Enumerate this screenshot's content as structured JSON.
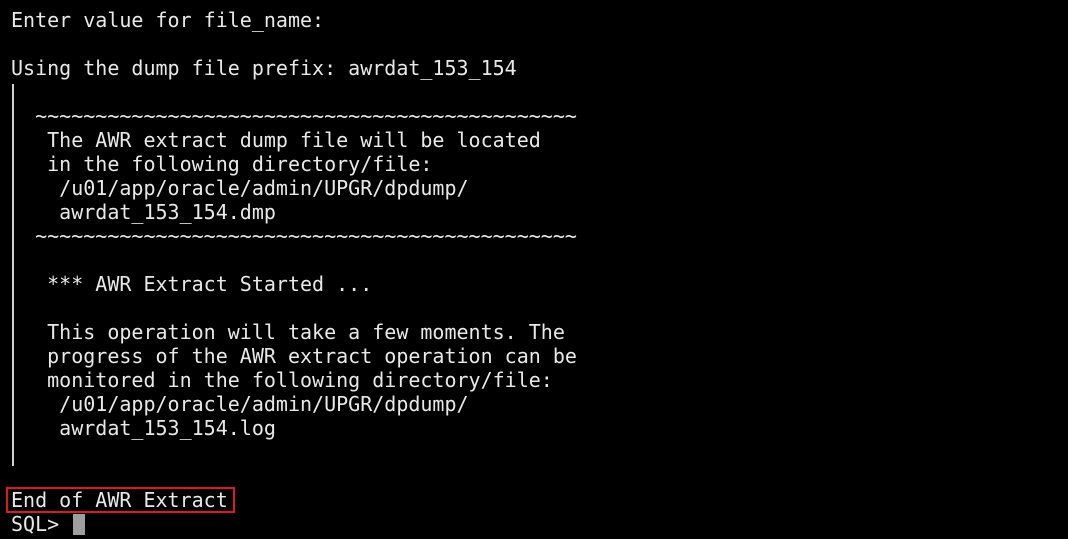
{
  "terminal": {
    "lines": [
      "Enter value for file_name:",
      "",
      "Using the dump file prefix: awrdat_153_154",
      "",
      "  ~~~~~~~~~~~~~~~~~~~~~~~~~~~~~~~~~~~~~~~~~~~~~",
      "   The AWR extract dump file will be located",
      "   in the following directory/file:",
      "    /u01/app/oracle/admin/UPGR/dpdump/",
      "    awrdat_153_154.dmp",
      "  ~~~~~~~~~~~~~~~~~~~~~~~~~~~~~~~~~~~~~~~~~~~~~",
      "",
      "   *** AWR Extract Started ...",
      "",
      "   This operation will take a few moments. The",
      "   progress of the AWR extract operation can be",
      "   monitored in the following directory/file:",
      "    /u01/app/oracle/admin/UPGR/dpdump/",
      "    awrdat_153_154.log",
      "",
      "",
      "End of AWR Extract"
    ],
    "prompt": "SQL>",
    "colors": {
      "background": "#000000",
      "text": "#e8e8e8",
      "highlight_border": "#e0191f",
      "cursor": "#9e9e9e"
    }
  }
}
